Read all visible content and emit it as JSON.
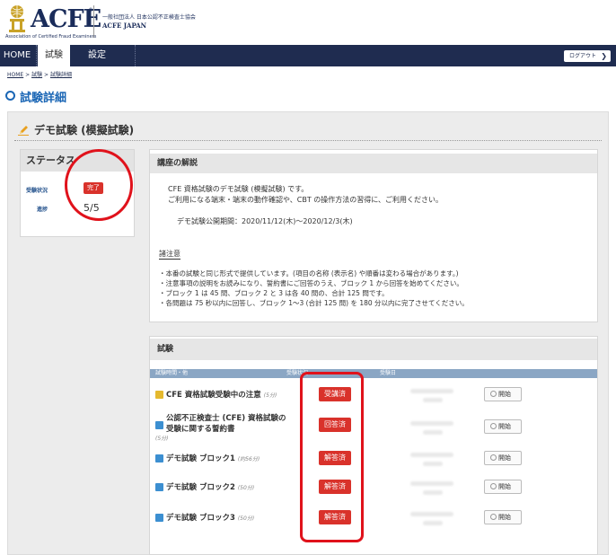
{
  "header": {
    "logo": "ACFE",
    "logo_reg": "®",
    "logo_sub": "Association of Certified Fraud Examiners",
    "org_jp": "一般社団法人 日本公認不正検査士協会",
    "org_en": "ACFE JAPAN"
  },
  "nav": {
    "items": [
      "HOME",
      "試験",
      "設定"
    ],
    "logout": "ログアウト"
  },
  "breadcrumb": {
    "home": "HOME",
    "sep": ">",
    "exam": "試験",
    "detail": "試験詳細"
  },
  "page_title": "試験詳細",
  "exam_name": "デモ試験 (模擬試験)",
  "status": {
    "heading": "ステータス",
    "state_label": "受験状況",
    "state_value": "完了",
    "progress_label": "進捗",
    "progress_value": "5/5"
  },
  "description": {
    "heading": "講座の解説",
    "lines": [
      "CFE 資格試験のデモ試験 (模擬試験) です。",
      "ご利用になる端末・端末の動作確認や、CBT の操作方法の習得に、ご利用ください。",
      "デモ試験公開期間：2020/11/12(木)〜2020/12/3(木)"
    ],
    "notes_heading": "諸注意",
    "notes": [
      "・本番の試験と同じ形式で提供しています。(項目の名称 (表示名) や順番は変わる場合があります。)",
      "・注意事項の説明をお読みになり、誓約書にご回答のうえ、ブロック 1 から回答を始めてください。",
      "・ブロック 1 は 45 問、ブロック 2 と 3 は各 40 問の、合計 125 問です。",
      "・各問題は 75 秒以内に回答し、ブロック 1〜3 (合計 125 問) を 180 分以内に完了させてください。"
    ]
  },
  "exam_table": {
    "heading": "試験",
    "columns": [
      "試験時間・他",
      "受験状況",
      "受験日"
    ],
    "rows": [
      {
        "icon": "yellow",
        "title": "CFE 資格試験受験中の注意",
        "time": "(5分)",
        "status": "受講済",
        "button": "開始"
      },
      {
        "icon": "blue",
        "title": "公認不正検査士 (CFE) 資格試験の",
        "title2": "受験に関する誓約書",
        "time": "(5分)",
        "status": "回答済",
        "button": "開始"
      },
      {
        "icon": "blue",
        "title": "デモ試験 ブロック1",
        "time": "(約56分)",
        "status": "解答済",
        "button": "開始"
      },
      {
        "icon": "blue",
        "title": "デモ試験 ブロック2",
        "time": "(50分)",
        "status": "解答済",
        "button": "開始"
      },
      {
        "icon": "blue",
        "title": "デモ試験 ブロック3",
        "time": "(50分)",
        "status": "解答済",
        "button": "開始"
      }
    ]
  },
  "colors": {
    "navy": "#1f2c50",
    "accent_blue": "#1a66b5",
    "badge_red": "#d9322b",
    "annotation_red": "#e0121b"
  }
}
